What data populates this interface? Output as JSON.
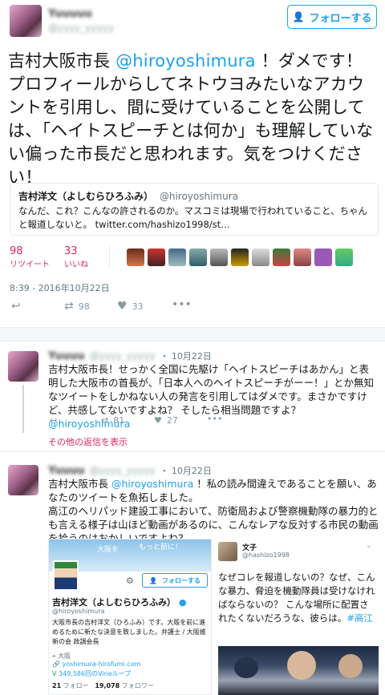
{
  "header": {
    "user_name": "Yuuuuu",
    "user_handle": "@yyyy_yyyyy",
    "follow_label": "フォローする"
  },
  "tweet": {
    "text_before_mention": "吉村大阪市長 ",
    "mention": "@hiroyoshimura",
    "text_after_mention": " ！ダメです！ プロフィールからしてネトウヨみたいなアカウントを引用し、間に受けていることを公開しては、「ヘイトスピーチとは何か」も理解していない偏った市長だと思われます。気をつけください！",
    "quote": {
      "name": "吉村洋文（よしむらひろふみ）",
      "handle": "@hiroyoshimura",
      "text": "なんだ、これ？こんなの許されるのか。マスコミは現場で行われていること、ちゃんと報道しないと。 twitter.com/hashizo1998/st…"
    },
    "retweets_count": "98",
    "retweets_label": "リツイート",
    "likes_count": "33",
    "likes_label": "いいね",
    "timestamp": "8:39 - 2016年10月22日",
    "action_retweets": "98",
    "action_likes": "33"
  },
  "replies": [
    {
      "name": "Yuuuu",
      "handle": "@yyyy_yyyyy",
      "date": "・ 10月22日",
      "text_before": "吉村大阪市長！せっかく全国に先駆け「ヘイトスピーチはあかん」と表明した大阪市の首長が、「日本人へのヘイトスピーチがーー！」とか無知なツイートをしかねない人の発言を引用してはダメです。まさかですけど、共感してないですよね？ そしたら相当問題ですよ？",
      "mention": "@hiroyoshimura",
      "retweets": "81",
      "likes": "27",
      "more_replies": "その他の返信を表示"
    },
    {
      "name": "Yuuuu",
      "handle": "@yyyy_yyyyy",
      "date": "・ 10月22日",
      "text_prefix": "吉村大阪市長 ",
      "mention": "@hiroyoshimura",
      "text_after": " ！私の読み間違えであることを願い、あなたのツイートを魚拓しました。",
      "text_body": "高江のヘリパッド建設工事において、防衛局および警察機動隊の暴力的とも言える様子は山ほど動画があるのに、こんなレアな反対する市民の動画を拾うのはおかしいですよね？"
    }
  ],
  "embedded_left": {
    "banner_text": "大阪を",
    "banner_text2": "もっと前に！",
    "follow_label": "フォローする",
    "name": "吉村洋文（よしむらひろふみ）",
    "handle": "@hiroyoshimura",
    "bio": "大阪市長の吉村洋文（ひろふみ）です。大阪を前に進めるために新たな決意を致しました。弁護士 / 大阪維新の会 政調会長",
    "location": "大阪",
    "website": "yoshimura-hirofumi.com",
    "vine": "349,586回のVineループ",
    "following_count": "21",
    "following_label": "フォロー",
    "followers_count": "19,078",
    "followers_label": "フォロワー"
  },
  "embedded_right": {
    "name": "文子",
    "handle": "@hashizo1998",
    "text": "なぜコレを報道しないの？なぜ、こんな暴力、脅迫を機動隊員は受けなければならないの？ こんな場所に配置されたくないだろうな、彼らは。",
    "hashtag": "#高江"
  }
}
